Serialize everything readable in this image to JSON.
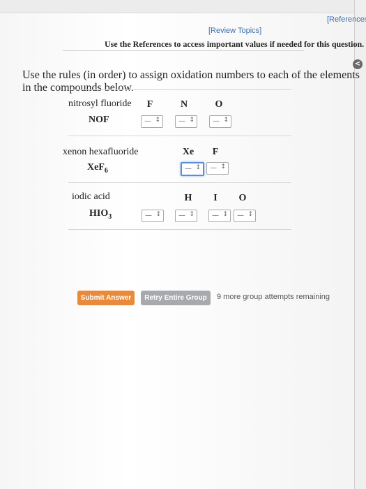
{
  "header": {
    "references_label": "[References]",
    "review_topics_label": "[Review Topics]",
    "references_note": "Use the References to access important values if needed for this question."
  },
  "question": {
    "instruction": "Use the rules (in order) to assign oxidation numbers to each of the elements in the compounds below."
  },
  "compounds": [
    {
      "name": "nitrosyl fluoride",
      "formula": "NOF",
      "elements": [
        "F",
        "N",
        "O"
      ]
    },
    {
      "name": "xenon hexafluoride",
      "formula_main": "XeF",
      "formula_sub": "6",
      "elements": [
        "Xe",
        "F"
      ]
    },
    {
      "name": "iodic acid",
      "formula_main": "HIO",
      "formula_sub": "3",
      "elements": [
        "H",
        "I",
        "O"
      ]
    }
  ],
  "select": {
    "blank": "—",
    "arrow": "↕"
  },
  "footer": {
    "submit_label": "Submit Answer",
    "retry_label": "Retry Entire Group",
    "attempts_text": "9 more group attempts remaining"
  },
  "edge_knob_glyph": "<"
}
